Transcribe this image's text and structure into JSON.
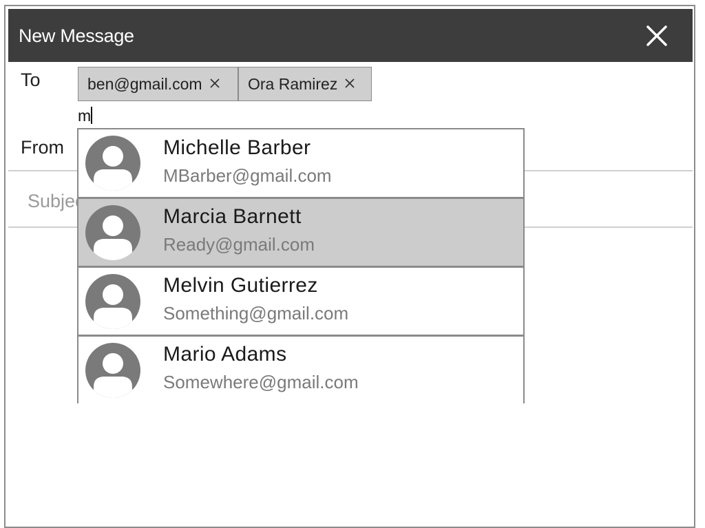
{
  "window": {
    "title": "New Message",
    "close_icon": "close-icon"
  },
  "form": {
    "to_label": "To",
    "from_label": "From",
    "subject_placeholder": "Subject",
    "to_input_value": "m",
    "recipients": [
      {
        "label": "ben@gmail.com",
        "remove_icon": "close-icon"
      },
      {
        "label": "Ora Ramirez",
        "remove_icon": "close-icon"
      }
    ]
  },
  "suggestions": [
    {
      "name": "Michelle Barber",
      "email": "MBarber@gmail.com",
      "selected": false,
      "icon": "avatar-icon"
    },
    {
      "name": "Marcia Barnett",
      "email": "Ready@gmail.com",
      "selected": true,
      "icon": "avatar-icon"
    },
    {
      "name": "Melvin Gutierrez",
      "email": "Something@gmail.com",
      "selected": false,
      "icon": "avatar-icon"
    },
    {
      "name": "Mario Adams",
      "email": "Somewhere@gmail.com",
      "selected": false,
      "icon": "avatar-icon"
    }
  ],
  "colors": {
    "header_bg": "#3d3d3d",
    "chip_bg": "#cfcfcf",
    "selected_bg": "#cccccc",
    "avatar": "#7a7a7a"
  }
}
